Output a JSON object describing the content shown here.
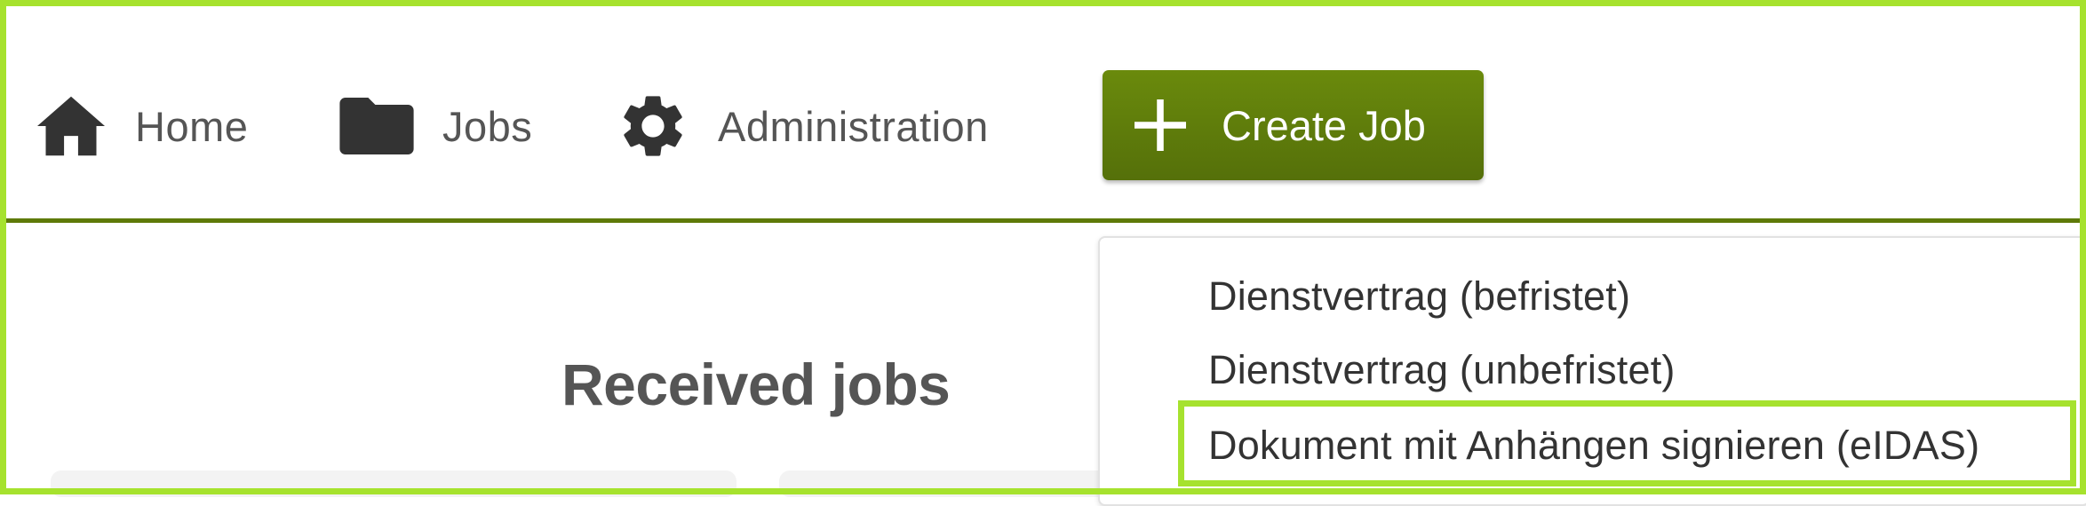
{
  "nav": {
    "home": {
      "label": "Home",
      "icon": "home-icon"
    },
    "jobs": {
      "label": "Jobs",
      "icon": "folder-icon"
    },
    "administration": {
      "label": "Administration",
      "icon": "gear-icon"
    },
    "create_job": {
      "label": "Create Job",
      "icon": "plus-icon"
    }
  },
  "main": {
    "title": "Received jobs"
  },
  "create_job_menu": {
    "items": [
      {
        "label": "Dienstvertrag (befristet)"
      },
      {
        "label": "Dienstvertrag (unbefristet)"
      },
      {
        "label": "Dokument mit Anhängen signieren (eIDAS)"
      }
    ]
  },
  "colors": {
    "accent_green": "#5e7a08",
    "highlight_lime": "#a6e22e",
    "text_gray": "#555555"
  }
}
